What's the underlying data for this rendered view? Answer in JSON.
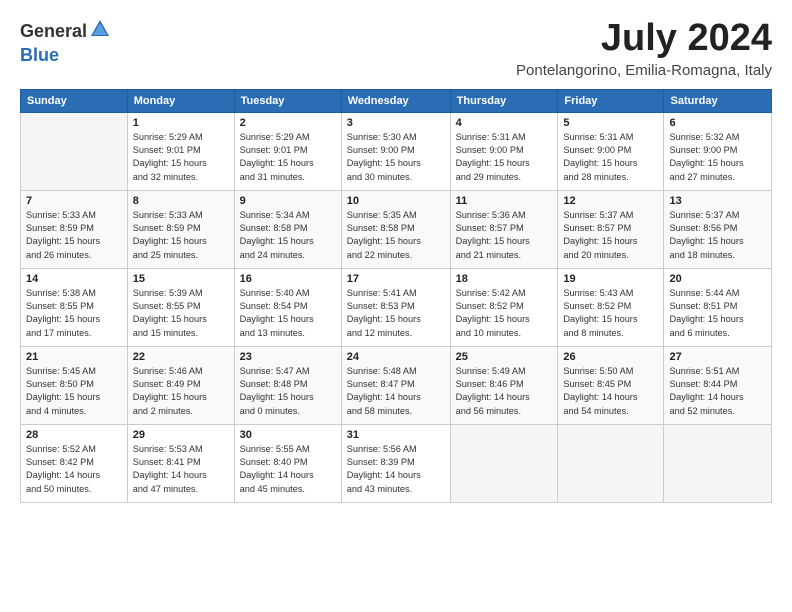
{
  "logo": {
    "general": "General",
    "blue": "Blue"
  },
  "title": "July 2024",
  "subtitle": "Pontelangorino, Emilia-Romagna, Italy",
  "headers": [
    "Sunday",
    "Monday",
    "Tuesday",
    "Wednesday",
    "Thursday",
    "Friday",
    "Saturday"
  ],
  "weeks": [
    [
      {
        "day": "",
        "detail": ""
      },
      {
        "day": "1",
        "detail": "Sunrise: 5:29 AM\nSunset: 9:01 PM\nDaylight: 15 hours\nand 32 minutes."
      },
      {
        "day": "2",
        "detail": "Sunrise: 5:29 AM\nSunset: 9:01 PM\nDaylight: 15 hours\nand 31 minutes."
      },
      {
        "day": "3",
        "detail": "Sunrise: 5:30 AM\nSunset: 9:00 PM\nDaylight: 15 hours\nand 30 minutes."
      },
      {
        "day": "4",
        "detail": "Sunrise: 5:31 AM\nSunset: 9:00 PM\nDaylight: 15 hours\nand 29 minutes."
      },
      {
        "day": "5",
        "detail": "Sunrise: 5:31 AM\nSunset: 9:00 PM\nDaylight: 15 hours\nand 28 minutes."
      },
      {
        "day": "6",
        "detail": "Sunrise: 5:32 AM\nSunset: 9:00 PM\nDaylight: 15 hours\nand 27 minutes."
      }
    ],
    [
      {
        "day": "7",
        "detail": "Sunrise: 5:33 AM\nSunset: 8:59 PM\nDaylight: 15 hours\nand 26 minutes."
      },
      {
        "day": "8",
        "detail": "Sunrise: 5:33 AM\nSunset: 8:59 PM\nDaylight: 15 hours\nand 25 minutes."
      },
      {
        "day": "9",
        "detail": "Sunrise: 5:34 AM\nSunset: 8:58 PM\nDaylight: 15 hours\nand 24 minutes."
      },
      {
        "day": "10",
        "detail": "Sunrise: 5:35 AM\nSunset: 8:58 PM\nDaylight: 15 hours\nand 22 minutes."
      },
      {
        "day": "11",
        "detail": "Sunrise: 5:36 AM\nSunset: 8:57 PM\nDaylight: 15 hours\nand 21 minutes."
      },
      {
        "day": "12",
        "detail": "Sunrise: 5:37 AM\nSunset: 8:57 PM\nDaylight: 15 hours\nand 20 minutes."
      },
      {
        "day": "13",
        "detail": "Sunrise: 5:37 AM\nSunset: 8:56 PM\nDaylight: 15 hours\nand 18 minutes."
      }
    ],
    [
      {
        "day": "14",
        "detail": "Sunrise: 5:38 AM\nSunset: 8:55 PM\nDaylight: 15 hours\nand 17 minutes."
      },
      {
        "day": "15",
        "detail": "Sunrise: 5:39 AM\nSunset: 8:55 PM\nDaylight: 15 hours\nand 15 minutes."
      },
      {
        "day": "16",
        "detail": "Sunrise: 5:40 AM\nSunset: 8:54 PM\nDaylight: 15 hours\nand 13 minutes."
      },
      {
        "day": "17",
        "detail": "Sunrise: 5:41 AM\nSunset: 8:53 PM\nDaylight: 15 hours\nand 12 minutes."
      },
      {
        "day": "18",
        "detail": "Sunrise: 5:42 AM\nSunset: 8:52 PM\nDaylight: 15 hours\nand 10 minutes."
      },
      {
        "day": "19",
        "detail": "Sunrise: 5:43 AM\nSunset: 8:52 PM\nDaylight: 15 hours\nand 8 minutes."
      },
      {
        "day": "20",
        "detail": "Sunrise: 5:44 AM\nSunset: 8:51 PM\nDaylight: 15 hours\nand 6 minutes."
      }
    ],
    [
      {
        "day": "21",
        "detail": "Sunrise: 5:45 AM\nSunset: 8:50 PM\nDaylight: 15 hours\nand 4 minutes."
      },
      {
        "day": "22",
        "detail": "Sunrise: 5:46 AM\nSunset: 8:49 PM\nDaylight: 15 hours\nand 2 minutes."
      },
      {
        "day": "23",
        "detail": "Sunrise: 5:47 AM\nSunset: 8:48 PM\nDaylight: 15 hours\nand 0 minutes."
      },
      {
        "day": "24",
        "detail": "Sunrise: 5:48 AM\nSunset: 8:47 PM\nDaylight: 14 hours\nand 58 minutes."
      },
      {
        "day": "25",
        "detail": "Sunrise: 5:49 AM\nSunset: 8:46 PM\nDaylight: 14 hours\nand 56 minutes."
      },
      {
        "day": "26",
        "detail": "Sunrise: 5:50 AM\nSunset: 8:45 PM\nDaylight: 14 hours\nand 54 minutes."
      },
      {
        "day": "27",
        "detail": "Sunrise: 5:51 AM\nSunset: 8:44 PM\nDaylight: 14 hours\nand 52 minutes."
      }
    ],
    [
      {
        "day": "28",
        "detail": "Sunrise: 5:52 AM\nSunset: 8:42 PM\nDaylight: 14 hours\nand 50 minutes."
      },
      {
        "day": "29",
        "detail": "Sunrise: 5:53 AM\nSunset: 8:41 PM\nDaylight: 14 hours\nand 47 minutes."
      },
      {
        "day": "30",
        "detail": "Sunrise: 5:55 AM\nSunset: 8:40 PM\nDaylight: 14 hours\nand 45 minutes."
      },
      {
        "day": "31",
        "detail": "Sunrise: 5:56 AM\nSunset: 8:39 PM\nDaylight: 14 hours\nand 43 minutes."
      },
      {
        "day": "",
        "detail": ""
      },
      {
        "day": "",
        "detail": ""
      },
      {
        "day": "",
        "detail": ""
      }
    ]
  ]
}
